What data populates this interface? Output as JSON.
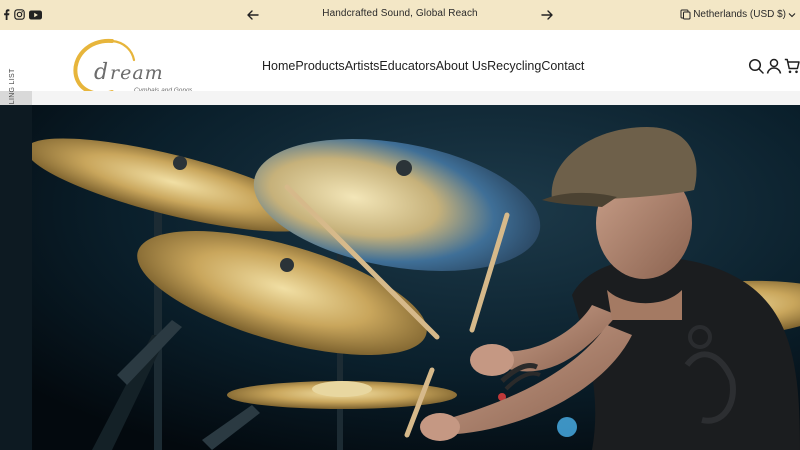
{
  "announcement": {
    "text": "Handcrafted Sound, Global Reach",
    "prev_icon": "arrow-left-icon",
    "next_icon": "arrow-right-icon"
  },
  "social": [
    "facebook-icon",
    "instagram-icon",
    "youtube-icon"
  ],
  "locale": {
    "label": "Netherlands (USD $)",
    "icon": "globe-icon"
  },
  "logo": {
    "brand": "Dream",
    "tagline": "Cymbals and Gongs",
    "accent": "#e7b53b"
  },
  "nav": {
    "items": [
      "Home",
      "Products",
      "Artists",
      "Educators",
      "About Us",
      "Recycling",
      "Contact"
    ]
  },
  "header_icons": [
    "search-icon",
    "account-icon",
    "cart-icon"
  ],
  "mailing_tab": {
    "label": "SUBSCRIBE TO OUR MAILING LIST"
  },
  "colors": {
    "announcement_bg": "#f3e7c6",
    "text": "#1f1f1f",
    "hero_bg": "#06131c"
  }
}
